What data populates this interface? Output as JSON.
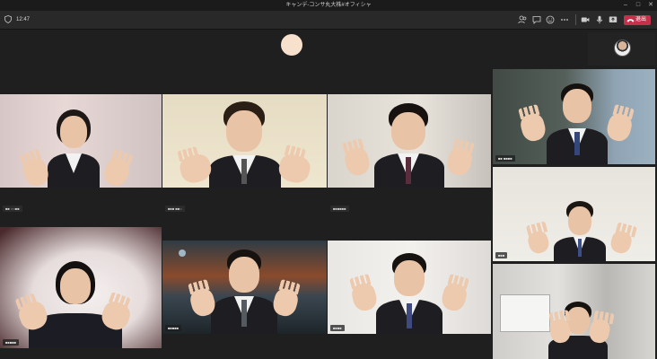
{
  "window": {
    "title": "キャンデ-コンサ丸大株#オフィシャ",
    "timer": "12:47",
    "controls": [
      "minimize-icon",
      "maximize-icon",
      "close-icon"
    ]
  },
  "toolbar": {
    "icons": [
      "participants-icon",
      "chat-icon",
      "reactions-icon",
      "more-icon",
      "camera-icon",
      "mic-icon",
      "share-icon"
    ],
    "leave_label": "退出",
    "leave_color": "#c4314b"
  },
  "stage": {
    "accent": "#7a7fd8",
    "tiles": [
      {
        "id": "tile-1",
        "name": "■■ ○○■■"
      },
      {
        "id": "tile-2",
        "name": "■■■ ■■○"
      },
      {
        "id": "tile-3",
        "name": "■■■■■■"
      },
      {
        "id": "tile-4",
        "name": "■■■■■"
      },
      {
        "id": "tile-5",
        "name": "■■■■■"
      },
      {
        "id": "tile-6",
        "name": "■■■■"
      },
      {
        "id": "tile-7",
        "name": "■■ ■■■■"
      },
      {
        "id": "tile-8",
        "name": "■■■"
      },
      {
        "id": "tile-9",
        "name": "■■■■■■"
      },
      {
        "id": "tile-10",
        "name": ""
      }
    ]
  }
}
